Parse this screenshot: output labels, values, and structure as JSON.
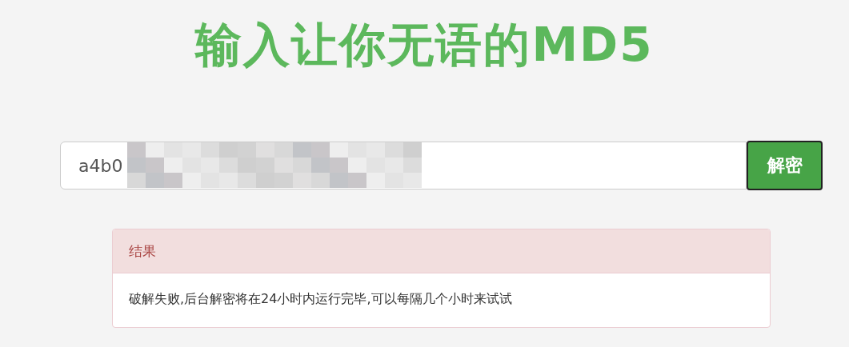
{
  "title": "输入让你无语的MD5",
  "search": {
    "value": "a4b0",
    "button": "解密"
  },
  "result": {
    "heading": "结果",
    "message": "破解失败,后台解密将在24小时内运行完毕,可以每隔几个小时来试试"
  }
}
